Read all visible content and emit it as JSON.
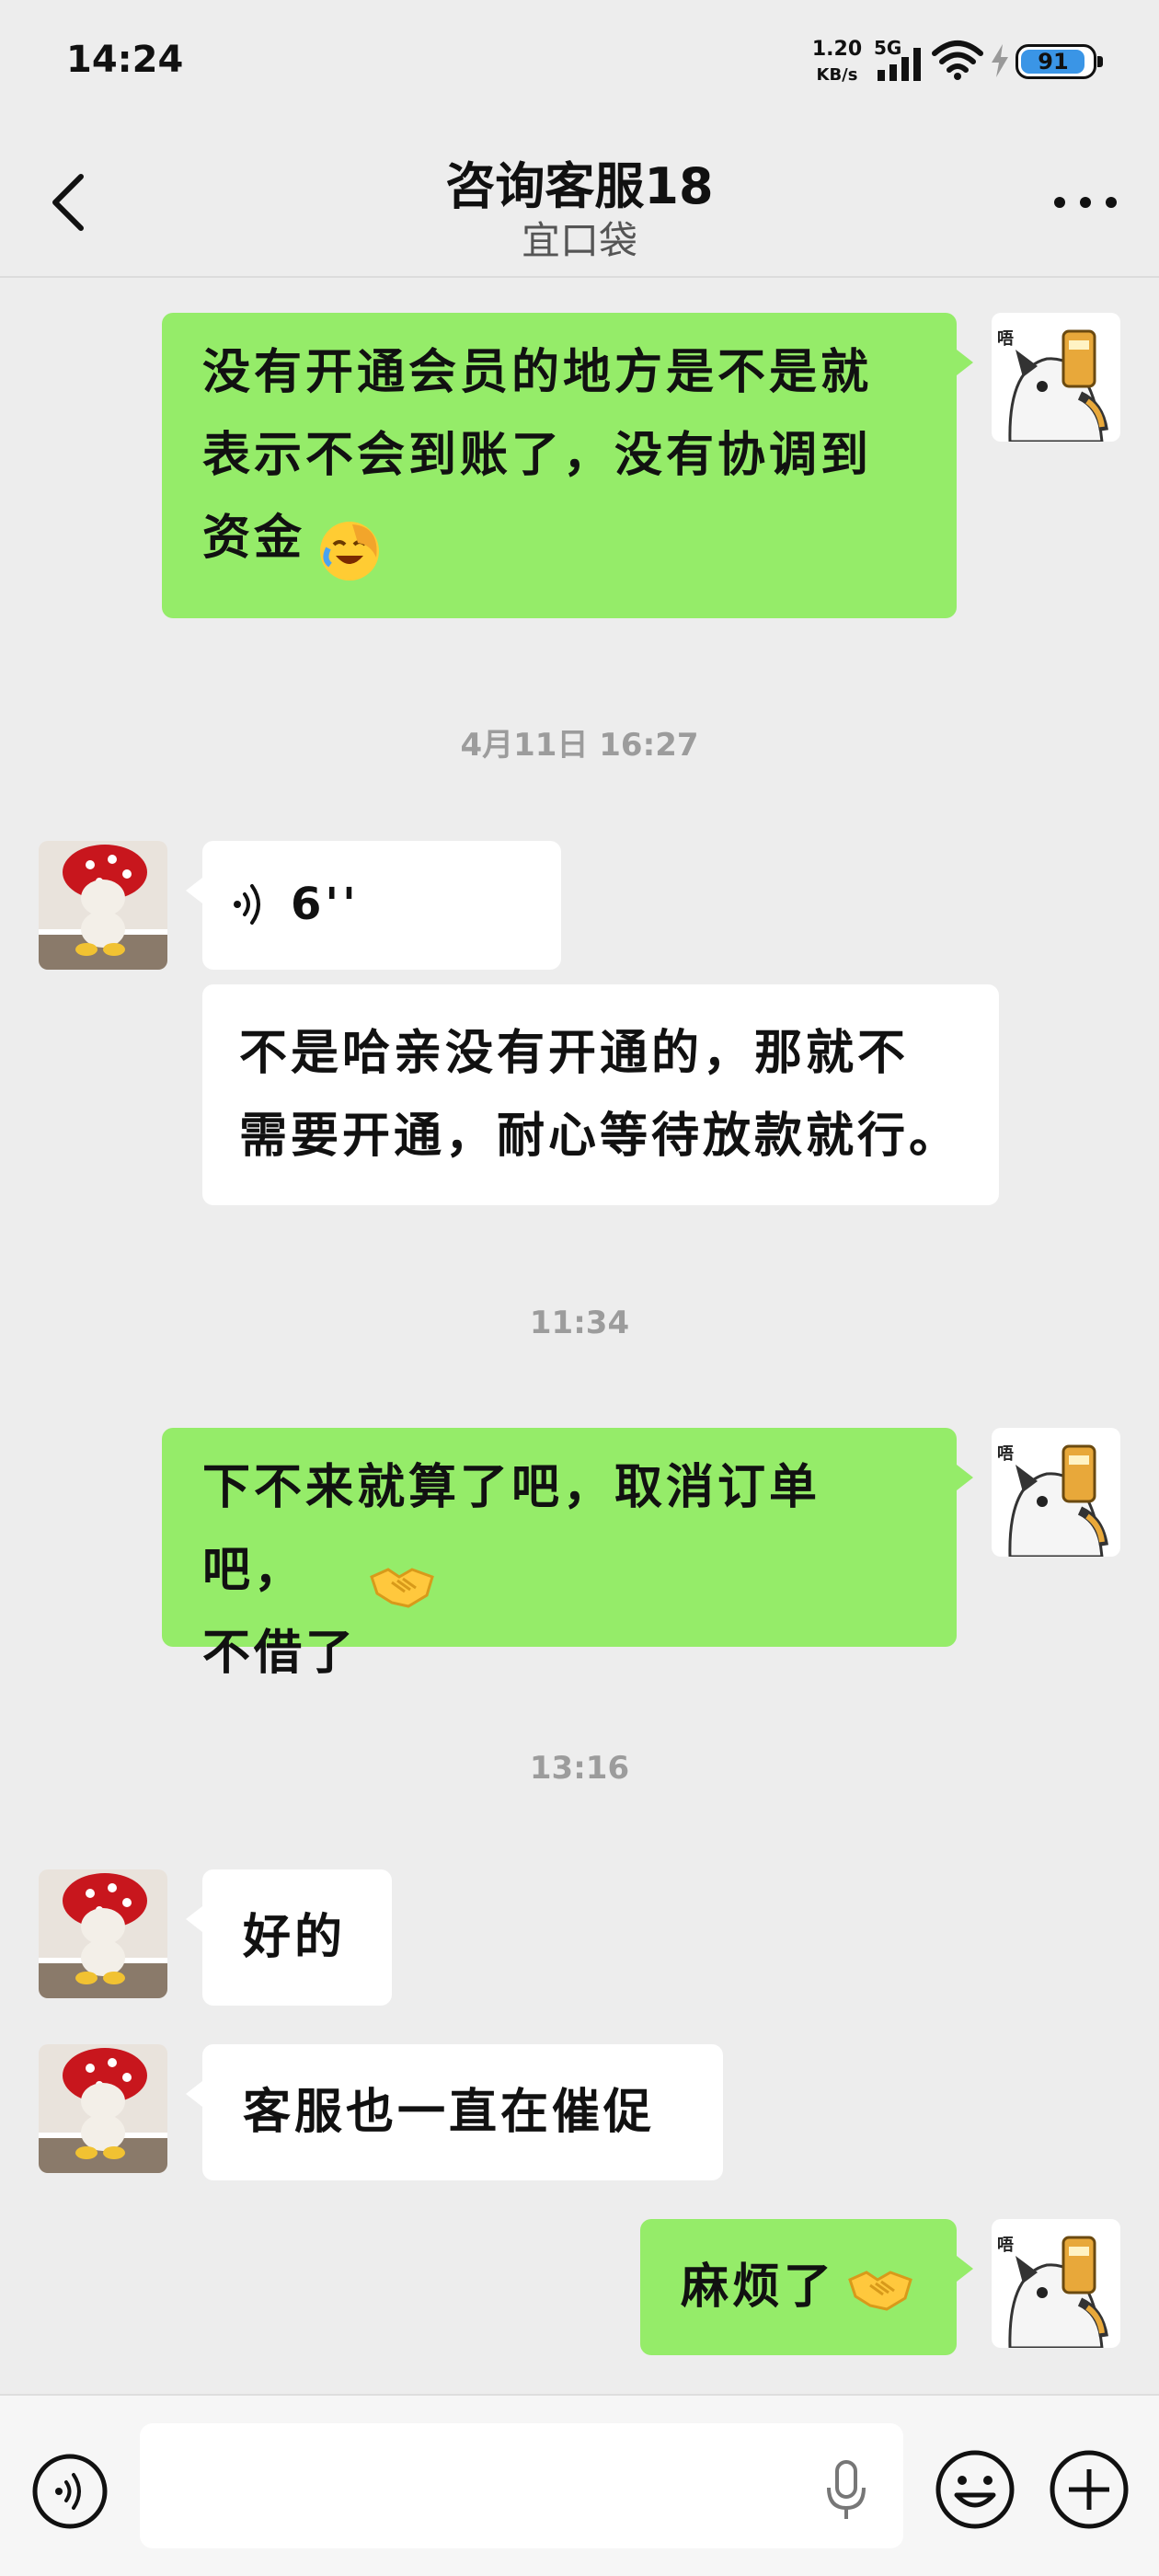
{
  "status_bar": {
    "time": "14:24",
    "net_speed_value": "1.20",
    "net_speed_unit": "KB/s",
    "network_type": "5G",
    "battery_level": "91",
    "battery_fraction": 0.91
  },
  "header": {
    "title": "咨询客服18",
    "subtitle": "宜口袋"
  },
  "messages": [
    {
      "type": "text",
      "direction": "out",
      "text": "没有开通会员的地方是不是就\n表示不会到账了，没有协调到\n资金",
      "emoji": "face-palm-laugh-emoji"
    },
    {
      "type": "time",
      "text": "4月11日 16:27"
    },
    {
      "type": "voice",
      "direction": "in",
      "duration": "6''"
    },
    {
      "type": "text",
      "direction": "in",
      "text": "不是哈亲没有开通的，那就不\n需要开通，耐心等待放款就行。"
    },
    {
      "type": "time",
      "text": "11:34"
    },
    {
      "type": "text",
      "direction": "out",
      "text": "下不来就算了吧，取消订单吧，\n不借了",
      "emoji": "handshake-emoji"
    },
    {
      "type": "time",
      "text": "13:16"
    },
    {
      "type": "text",
      "direction": "in",
      "text": "好的"
    },
    {
      "type": "text",
      "direction": "in",
      "text": "客服也一直在催促"
    },
    {
      "type": "text",
      "direction": "out",
      "text": "麻烦了",
      "emoji": "handshake-emoji"
    }
  ],
  "input": {
    "placeholder": ""
  },
  "colors": {
    "outgoing_bubble": "#95ec69",
    "incoming_bubble": "#ffffff",
    "background": "#ededed",
    "battery_accent": "#3a95e6"
  }
}
